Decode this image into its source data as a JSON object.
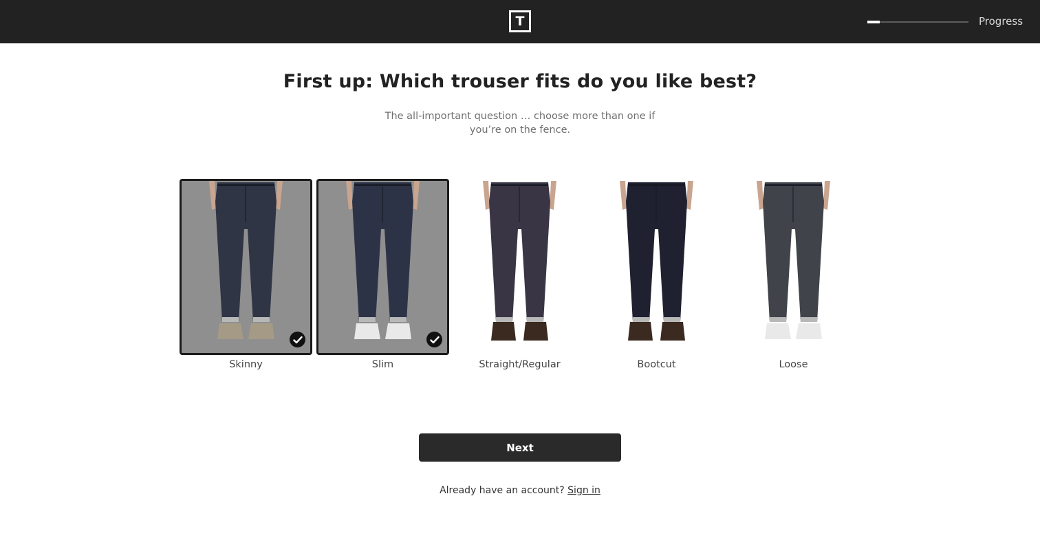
{
  "header": {
    "logo_letter": "T",
    "progress_label": "Progress",
    "progress_fraction": 0.12
  },
  "question": {
    "title": "First up: Which trouser fits do you like best?",
    "subtitle": "The all-important question … choose more than one if you’re on the fence."
  },
  "options": [
    {
      "label": "Skinny",
      "selected": true,
      "denim_color": "#2f3545",
      "shoe": "tan-sneakers"
    },
    {
      "label": "Slim",
      "selected": true,
      "denim_color": "#2d3347",
      "shoe": "white-sneakers"
    },
    {
      "label": "Straight/Regular",
      "selected": false,
      "denim_color": "#3a3545",
      "shoe": "brown-boots"
    },
    {
      "label": "Bootcut",
      "selected": false,
      "denim_color": "#1f2030",
      "shoe": "brown-boots"
    },
    {
      "label": "Loose",
      "selected": false,
      "denim_color": "#41434a",
      "shoe": "white-sneakers"
    }
  ],
  "actions": {
    "next_label": "Next",
    "account_prompt": "Already have an account?",
    "signin_label": "Sign in"
  },
  "icons": {
    "logo": "logo-t-icon",
    "selected": "checkmark-icon"
  }
}
